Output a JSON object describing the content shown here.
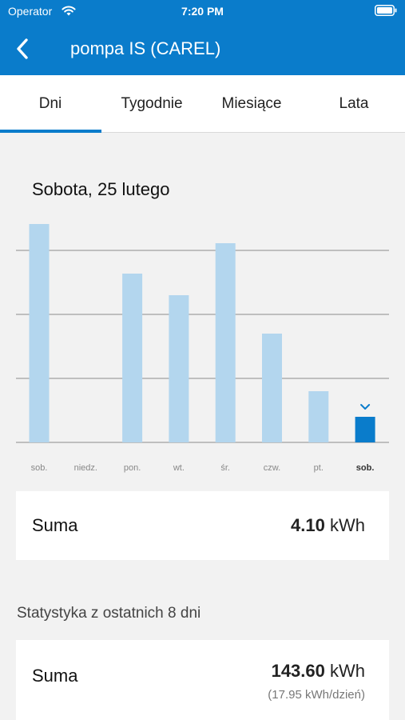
{
  "status_bar": {
    "carrier": "Operator",
    "time": "7:20 PM"
  },
  "nav": {
    "title": "pompa IS (CAREL)",
    "back_icon": "chevron-left-icon"
  },
  "tabs": [
    {
      "label": "Dni",
      "selected": true
    },
    {
      "label": "Tygodnie",
      "selected": false
    },
    {
      "label": "Miesiące",
      "selected": false
    },
    {
      "label": "Lata",
      "selected": false
    }
  ],
  "selected_day_title": "Sobota, 25 lutego",
  "chart_data": {
    "type": "bar",
    "categories": [
      "sob.",
      "niedz.",
      "pon.",
      "wt.",
      "śr.",
      "czw.",
      "pt.",
      "sob."
    ],
    "values": [
      13.65,
      0,
      10.55,
      9.2,
      12.45,
      6.8,
      3.2,
      1.6
    ],
    "selected_index": 7,
    "grid": true,
    "colors": {
      "bar": "#b3d6ee",
      "selected_bar": "#0a7ccb"
    }
  },
  "summary": {
    "label": "Suma",
    "value": "4.10",
    "unit": "kWh"
  },
  "stats": {
    "heading": "Statystyka z ostatnich 8 dni",
    "label": "Suma",
    "value": "143.60",
    "unit": "kWh",
    "per_day": "(17.95 kWh/dzień)"
  },
  "colors": {
    "accent": "#0a7ccb",
    "background": "#f2f2f2"
  }
}
